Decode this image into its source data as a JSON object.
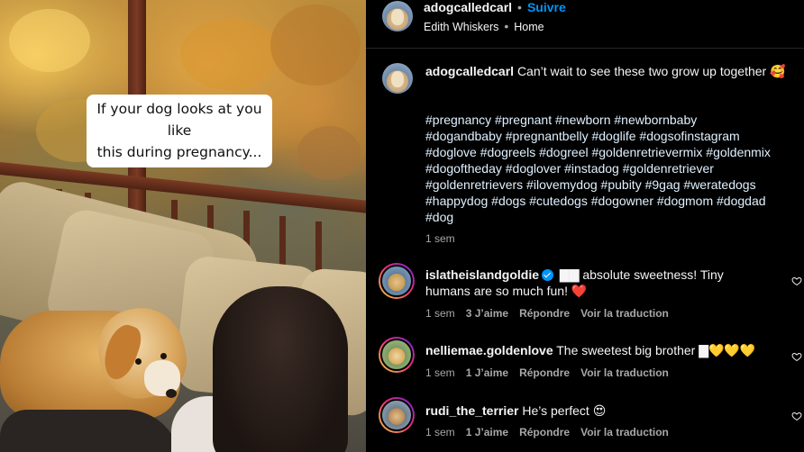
{
  "media": {
    "caption_line1": "If your dog looks at you like",
    "caption_line2": "this during pregnancy..."
  },
  "header": {
    "username": "adogcalledcarl",
    "separator": "•",
    "follow_label": "Suivre",
    "audio": "Edith Whiskers",
    "location_separator": "•",
    "location": "Home"
  },
  "post": {
    "username": "adogcalledcarl",
    "text": "Can’t wait to see these two grow up together 🥰",
    "hashtags": [
      "#pregnancy #pregnant #newborn #newbornbaby",
      "#dogandbaby #pregnantbelly #doglife #dogsofinstagram",
      "#doglove #dogreels #dogreel #goldenretrievermix #goldenmix",
      "#dogoftheday #doglover #instadog #goldenretriever",
      "#goldenretrievers #ilovemydog #pubity #9gag #weratedogs",
      "#happydog #dogs #cutedogs #dogowner #dogmom #dogdad",
      "#dog"
    ],
    "age": "1 sem"
  },
  "comments": [
    {
      "username": "islatheislandgoldie",
      "verified": true,
      "text_line1": "▇▇ absolute sweetness! Tiny",
      "text_line2": "humans are so much fun! ❤️",
      "age": "1 sem",
      "likes": "3 J’aime",
      "reply": "Répondre",
      "translate": "Voir la traduction"
    },
    {
      "username": "nelliemae.goldenlove",
      "verified": false,
      "text_line1": "The sweetest big brother ▇💛💛💛",
      "age": "1 sem",
      "likes": "1 J’aime",
      "reply": "Répondre",
      "translate": "Voir la traduction"
    },
    {
      "username": "rudi_the_terrier",
      "verified": false,
      "text_line1": "He’s perfect 😍",
      "age": "1 sem",
      "likes": "1 J’aime",
      "reply": "Répondre",
      "translate": "Voir la traduction"
    }
  ],
  "icons": {
    "like": "heart-icon",
    "verified": "verified-badge-icon"
  },
  "colors": {
    "background": "#000000",
    "link_blue": "#0095f6",
    "muted": "#a8a8a8",
    "heart_red": "#ed1c24"
  }
}
